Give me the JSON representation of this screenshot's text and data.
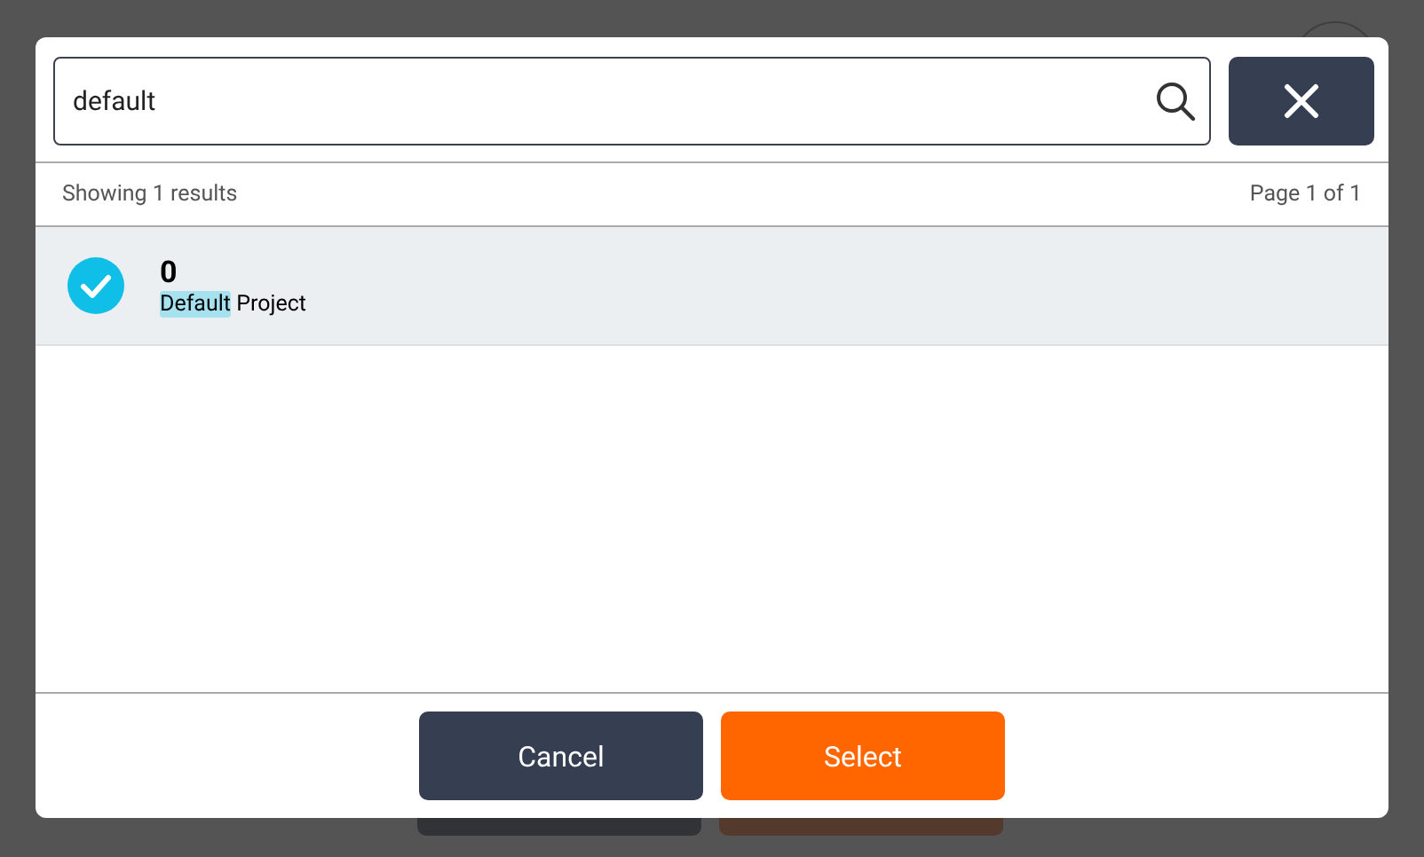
{
  "search": {
    "value": "default"
  },
  "summary": {
    "showing": "Showing 1 results",
    "page": "Page 1 of 1"
  },
  "results": [
    {
      "title": "0",
      "match": "Default",
      "rest": " Project",
      "selected": true
    }
  ],
  "buttons": [
    {
      "label": "Cancel",
      "kind": "secondary"
    },
    {
      "label": "Select",
      "kind": "primary"
    }
  ]
}
